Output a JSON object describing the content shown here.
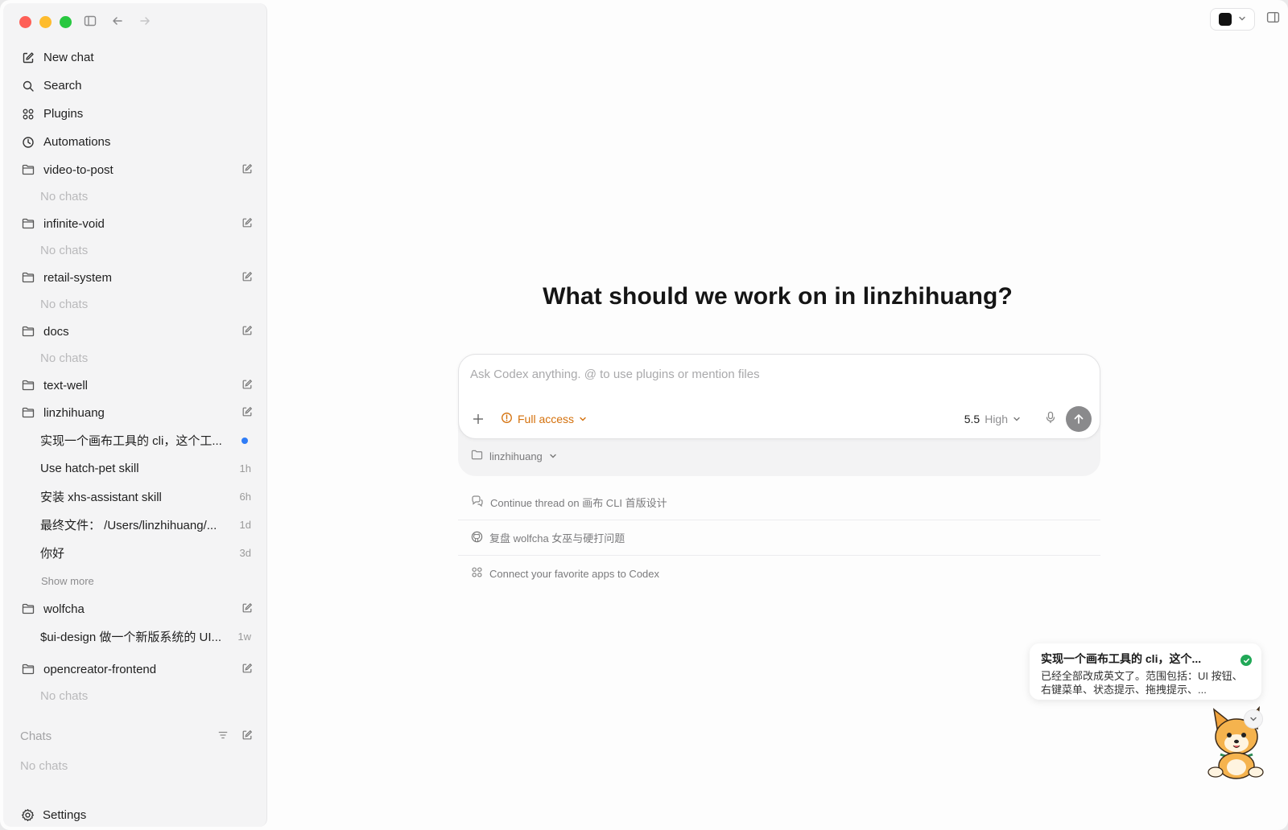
{
  "sidebar": {
    "nav": [
      {
        "label": "New chat",
        "icon": "edit-icon"
      },
      {
        "label": "Search",
        "icon": "search-icon"
      },
      {
        "label": "Plugins",
        "icon": "plugins-icon"
      },
      {
        "label": "Automations",
        "icon": "clock-icon"
      }
    ],
    "projects": [
      {
        "name": "video-to-post",
        "empty_label": "No chats"
      },
      {
        "name": "infinite-void",
        "empty_label": "No chats"
      },
      {
        "name": "retail-system",
        "empty_label": "No chats"
      },
      {
        "name": "docs",
        "empty_label": "No chats"
      },
      {
        "name": "text-well"
      },
      {
        "name": "linzhihuang",
        "threads": [
          {
            "title": "实现一个画布工具的 cli，这个工...",
            "time": "",
            "unread": true
          },
          {
            "title": "Use hatch-pet skill",
            "time": "1h"
          },
          {
            "title": "安装 xhs-assistant skill",
            "time": "6h"
          },
          {
            "title": "最终文件： /Users/linzhihuang/...",
            "time": "1d"
          },
          {
            "title": "你好",
            "time": "3d"
          }
        ],
        "show_more": "Show more"
      },
      {
        "name": "wolfcha",
        "threads": [
          {
            "title": "$ui-design 做一个新版系统的 UI...",
            "time": "1w"
          }
        ]
      },
      {
        "name": "opencreator-frontend",
        "empty_label": "No chats"
      }
    ],
    "chats_header": "Chats",
    "chats_empty": "No chats",
    "settings_label": "Settings"
  },
  "main": {
    "headline": "What should we work on in linzhihuang?",
    "composer": {
      "placeholder": "Ask Codex anything. @ to use plugins or mention files",
      "access_label": "Full access",
      "model_version": "5.5",
      "effort": "High",
      "project": "linzhihuang"
    },
    "suggestions": [
      {
        "label": "Continue thread on 画布 CLI 首版设计",
        "icon": "chat-bubbles-icon"
      },
      {
        "label": "复盘 wolfcha 女巫与硬打问题",
        "icon": "github-icon"
      },
      {
        "label": "Connect your favorite apps to Codex",
        "icon": "plugins-icon"
      }
    ]
  },
  "notification": {
    "title": "实现一个画布工具的 cli，这个...",
    "body": "已经全部改成英文了。范围包括：UI 按钮、右键菜单、状态提示、拖拽提示、..."
  },
  "colors": {
    "accent_orange": "#d4700b",
    "unread_blue": "#2f7cf6",
    "success_green": "#21a857"
  }
}
